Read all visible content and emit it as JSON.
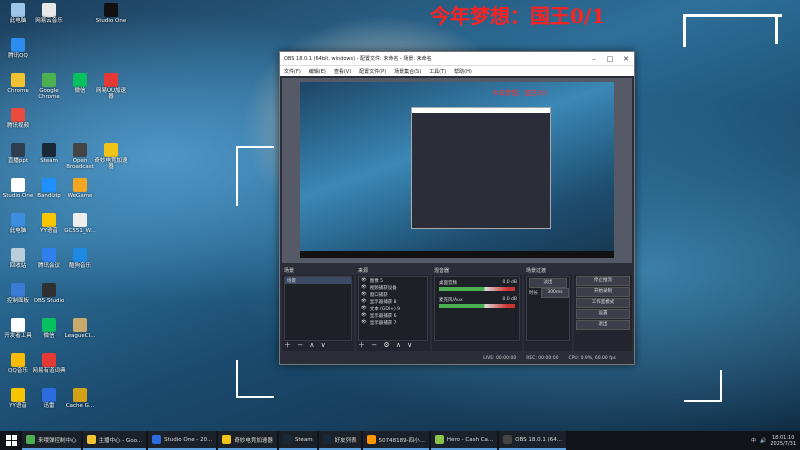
{
  "headline": "今年梦想：国王0/1",
  "desktop_icons": [
    {
      "label": "此电脑",
      "color": "#9ec6e8",
      "x": 0,
      "y": 0
    },
    {
      "label": "腾讯QQ",
      "color": "#2d8cf0",
      "x": 0,
      "y": 1
    },
    {
      "label": "Chrome",
      "color": "#f2c230",
      "x": 0,
      "y": 2
    },
    {
      "label": "腾讯视频",
      "color": "#e84c3d",
      "x": 0,
      "y": 3
    },
    {
      "label": "直播ppt",
      "color": "#2c3e50",
      "x": 0,
      "y": 4
    },
    {
      "label": "Studio One",
      "color": "#ffffff",
      "x": 0,
      "y": 5
    },
    {
      "label": "此电脑",
      "color": "#3d8ee0",
      "x": 0,
      "y": 6
    },
    {
      "label": "回收站",
      "color": "#bcd",
      "x": 0,
      "y": 7
    },
    {
      "label": "控制面板",
      "color": "#3a7bd5",
      "x": 0,
      "y": 8
    },
    {
      "label": "开发者工具",
      "color": "#ffffff",
      "x": 0,
      "y": 9
    },
    {
      "label": "QQ音乐",
      "color": "#fbbc05",
      "x": 0,
      "y": 10
    },
    {
      "label": "YY语音",
      "color": "#f7c600",
      "x": 0,
      "y": 11
    },
    {
      "label": "网易云音乐",
      "color": "#e8e8e8",
      "x": 1,
      "y": 0
    },
    {
      "label": "Google Chrome",
      "color": "#4caf50",
      "x": 1,
      "y": 2
    },
    {
      "label": "Steam",
      "color": "#1b2838",
      "x": 1,
      "y": 4
    },
    {
      "label": "Bandizip",
      "color": "#1e90ff",
      "x": 1,
      "y": 5
    },
    {
      "label": "YY语音",
      "color": "#f7c600",
      "x": 1,
      "y": 6
    },
    {
      "label": "腾讯会议",
      "color": "#2f80ed",
      "x": 1,
      "y": 7
    },
    {
      "label": "OBS Studio",
      "color": "#303030",
      "x": 1,
      "y": 8
    },
    {
      "label": "微信",
      "color": "#07c160",
      "x": 1,
      "y": 9
    },
    {
      "label": "网易有道词典",
      "color": "#e53935",
      "x": 1,
      "y": 10
    },
    {
      "label": "迅雷",
      "color": "#2d6cdf",
      "x": 1,
      "y": 11
    },
    {
      "label": "Open Broadcast",
      "color": "#444",
      "x": 2,
      "y": 4
    },
    {
      "label": "WeGame",
      "color": "#f5a623",
      "x": 2,
      "y": 5
    },
    {
      "label": "GC551_W...",
      "color": "#eee",
      "x": 2,
      "y": 6
    },
    {
      "label": "酷狗音乐",
      "color": "#1e88e5",
      "x": 2,
      "y": 7
    },
    {
      "label": "LeagueCl...",
      "color": "#c8aa6e",
      "x": 2,
      "y": 9
    },
    {
      "label": "Cache G...",
      "color": "#d4a017",
      "x": 2,
      "y": 11
    },
    {
      "label": "微信",
      "color": "#07c160",
      "x": 2,
      "y": 2
    },
    {
      "label": "Studio One",
      "color": "#111",
      "x": 3,
      "y": 0
    },
    {
      "label": "网易UU加速器",
      "color": "#e53935",
      "x": 3,
      "y": 2
    },
    {
      "label": "奇妙电竞加速器",
      "color": "#f0c419",
      "x": 3,
      "y": 4
    }
  ],
  "obs": {
    "title": "OBS 18.0.1 (64bit, windows) - 配置文件: 未命名 - 场景: 未命名",
    "menu": [
      "文件(F)",
      "编辑(E)",
      "查看(V)",
      "配置文件(P)",
      "场景集合(S)",
      "工具(T)",
      "帮助(H)"
    ],
    "preview_headline": "今年梦想：国王0/1",
    "docks": {
      "scenes": {
        "title": "场景",
        "items": [
          "场景"
        ]
      },
      "sources": {
        "title": "来源",
        "items": [
          "图像 5",
          "视频捕获设备",
          "窗口捕获",
          "显示器捕获 8",
          "文本 (GDI+) 9",
          "显示器捕获 6",
          "显示器捕获 7"
        ]
      },
      "mixer": {
        "title": "混音器",
        "tracks": [
          {
            "name": "桌面音频",
            "level": "0.0 dB"
          },
          {
            "name": "麦克风/Aux",
            "level": "0.0 dB"
          }
        ]
      },
      "transitions": {
        "title": "场景过渡",
        "type": "淡出",
        "duration_label": "时长",
        "duration": "300ms"
      },
      "controls": [
        "停止推流",
        "开始录制",
        "工作室模式",
        "设置",
        "退出"
      ]
    },
    "status": {
      "live": "LIVE: 00:00:00",
      "rec": "REC: 00:00:00",
      "cpu": "CPU: 0.9%, 60.00 fps"
    }
  },
  "taskbar": {
    "items": [
      {
        "label": "来哦弹控制中心",
        "color": "#4caf50"
      },
      {
        "label": "主播中心 - Goo...",
        "color": "#f2c230"
      },
      {
        "label": "Studio One - 20...",
        "color": "#2d6cdf"
      },
      {
        "label": "奇妙电竞加速器",
        "color": "#f0c419"
      },
      {
        "label": "Steam",
        "color": "#1b2838"
      },
      {
        "label": "好友列表",
        "color": "#1b2838"
      },
      {
        "label": "50748189-四小...",
        "color": "#ff9800"
      },
      {
        "label": "Hero - Cash Ca...",
        "color": "#8bc34a"
      },
      {
        "label": "OBS 18.0.1 (64...",
        "color": "#444"
      }
    ],
    "time": "18:01:10",
    "date": "2025/7/31",
    "lang": "中"
  }
}
